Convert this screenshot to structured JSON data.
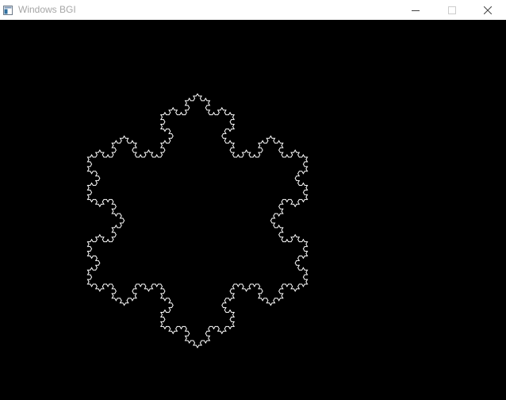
{
  "window": {
    "title": "Windows BGI",
    "icon": "app-window-icon",
    "controls": [
      "minimize-icon",
      "maximize-icon",
      "close-icon"
    ]
  },
  "canvas": {
    "background": "#000000",
    "line_color": "#ffffff",
    "figure": "koch-snowflake-inverted",
    "iterations": 4
  }
}
